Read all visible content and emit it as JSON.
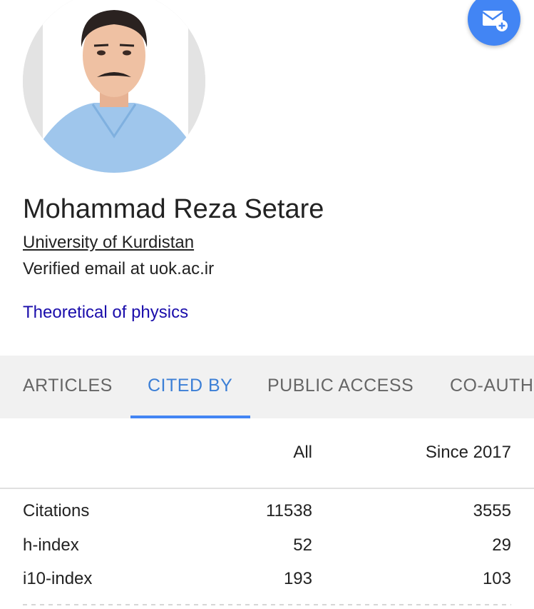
{
  "profile": {
    "name": "Mohammad Reza Setare",
    "affiliation": "University of Kurdistan",
    "email": "Verified email at uok.ac.ir",
    "interest": "Theoretical of physics"
  },
  "icons": {
    "follow": "email-plus-icon",
    "avatar": "profile-photo"
  },
  "tabs": [
    {
      "label": "ARTICLES"
    },
    {
      "label": "CITED BY"
    },
    {
      "label": "PUBLIC ACCESS"
    },
    {
      "label": "CO-AUTHORS"
    }
  ],
  "active_tab": "CITED BY",
  "citations": {
    "columns": [
      "All",
      "Since 2017"
    ],
    "rows": [
      {
        "label": "Citations",
        "all": "11538",
        "since": "3555"
      },
      {
        "label": "h-index",
        "all": "52",
        "since": "29"
      },
      {
        "label": "i10-index",
        "all": "193",
        "since": "103"
      }
    ]
  },
  "colors": {
    "accent": "#4285f4",
    "active_tab_text": "#3c7fd6",
    "link": "#1a0dab",
    "tab_bar_bg": "#f1f1f1"
  }
}
